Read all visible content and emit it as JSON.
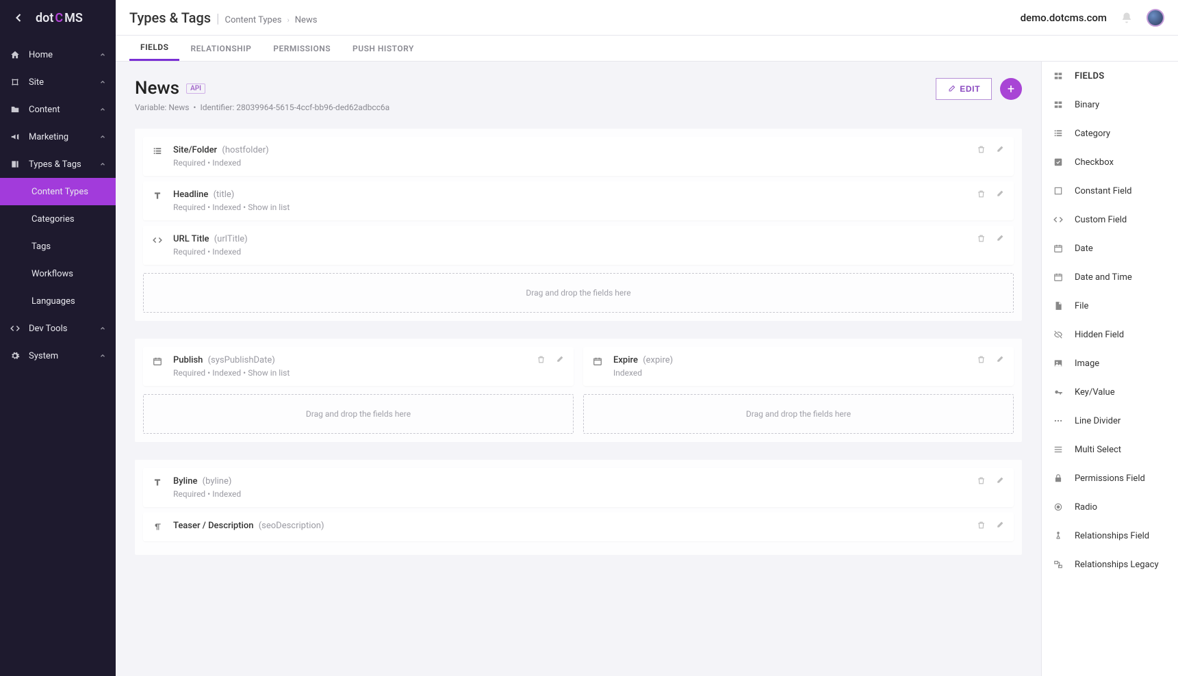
{
  "logo": {
    "pre": "dot",
    "accent": "C",
    "post": "MS"
  },
  "sidebar": [
    {
      "icon": "home-icon",
      "label": "Home",
      "expandable": true
    },
    {
      "icon": "site-icon",
      "label": "Site",
      "expandable": true
    },
    {
      "icon": "folder-icon",
      "label": "Content",
      "expandable": true
    },
    {
      "icon": "bullhorn-icon",
      "label": "Marketing",
      "expandable": true
    },
    {
      "icon": "tag-icon",
      "label": "Types & Tags",
      "expandable": true,
      "open": true
    },
    {
      "sub": true,
      "label": "Content Types",
      "active": true
    },
    {
      "sub": true,
      "label": "Categories"
    },
    {
      "sub": true,
      "label": "Tags"
    },
    {
      "sub": true,
      "label": "Workflows"
    },
    {
      "sub": true,
      "label": "Languages"
    },
    {
      "icon": "code-icon",
      "label": "Dev Tools",
      "expandable": true
    },
    {
      "icon": "gear-icon",
      "label": "System",
      "expandable": true
    }
  ],
  "breadcrumb": {
    "section": "Types & Tags",
    "crumbs": [
      "Content Types",
      "News"
    ]
  },
  "domain": "demo.dotcms.com",
  "tabs": [
    {
      "label": "FIELDS",
      "active": true
    },
    {
      "label": "RELATIONSHIP"
    },
    {
      "label": "PERMISSIONS"
    },
    {
      "label": "PUSH HISTORY"
    }
  ],
  "page": {
    "title": "News",
    "badge": "API",
    "meta_variable_label": "Variable:",
    "meta_variable": "News",
    "meta_id_label": "Identifier:",
    "meta_id": "28039964-5615-4ccf-bb96-ded62adbcc6a",
    "edit_label": "EDIT"
  },
  "dropzone_text": "Drag and drop the fields here",
  "sections": [
    {
      "columns": [
        {
          "fields": [
            {
              "icon": "list-icon",
              "name": "Site/Folder",
              "var": "(hostfolder)",
              "attrs": "Required  •  Indexed"
            },
            {
              "icon": "text-icon",
              "name": "Headline",
              "var": "(title)",
              "attrs": "Required  •  Indexed  •  Show in list"
            },
            {
              "icon": "code-icon",
              "name": "URL Title",
              "var": "(urlTitle)",
              "attrs": "Required  •  Indexed"
            }
          ]
        }
      ]
    },
    {
      "columns": [
        {
          "fields": [
            {
              "icon": "calendar-icon",
              "name": "Publish",
              "var": "(sysPublishDate)",
              "attrs": "Required  •  Indexed  •  Show in list"
            }
          ]
        },
        {
          "fields": [
            {
              "icon": "calendar-icon",
              "name": "Expire",
              "var": "(expire)",
              "attrs": "Indexed"
            }
          ]
        }
      ]
    },
    {
      "columns": [
        {
          "fields": [
            {
              "icon": "text-icon",
              "name": "Byline",
              "var": "(byline)",
              "attrs": "Required  •  Indexed"
            },
            {
              "icon": "paragraph-icon",
              "name": "Teaser / Description",
              "var": "(seoDescription)",
              "attrs": ""
            }
          ],
          "no_dropzone": true
        }
      ]
    }
  ],
  "right_panel": {
    "header": "FIELDS",
    "items": [
      {
        "icon": "binary-icon",
        "label": "Binary"
      },
      {
        "icon": "list-icon",
        "label": "Category"
      },
      {
        "icon": "checkbox-icon",
        "label": "Checkbox"
      },
      {
        "icon": "square-icon",
        "label": "Constant Field"
      },
      {
        "icon": "code-icon",
        "label": "Custom Field"
      },
      {
        "icon": "calendar-icon",
        "label": "Date"
      },
      {
        "icon": "calendar-icon",
        "label": "Date and Time"
      },
      {
        "icon": "file-icon",
        "label": "File"
      },
      {
        "icon": "hidden-icon",
        "label": "Hidden Field"
      },
      {
        "icon": "image-icon",
        "label": "Image"
      },
      {
        "icon": "key-icon",
        "label": "Key/Value"
      },
      {
        "icon": "dots-icon",
        "label": "Line Divider"
      },
      {
        "icon": "multiselect-icon",
        "label": "Multi Select"
      },
      {
        "icon": "lock-icon",
        "label": "Permissions Field"
      },
      {
        "icon": "radio-icon",
        "label": "Radio"
      },
      {
        "icon": "relation-icon",
        "label": "Relationships Field"
      },
      {
        "icon": "relation2-icon",
        "label": "Relationships Legacy"
      }
    ]
  }
}
